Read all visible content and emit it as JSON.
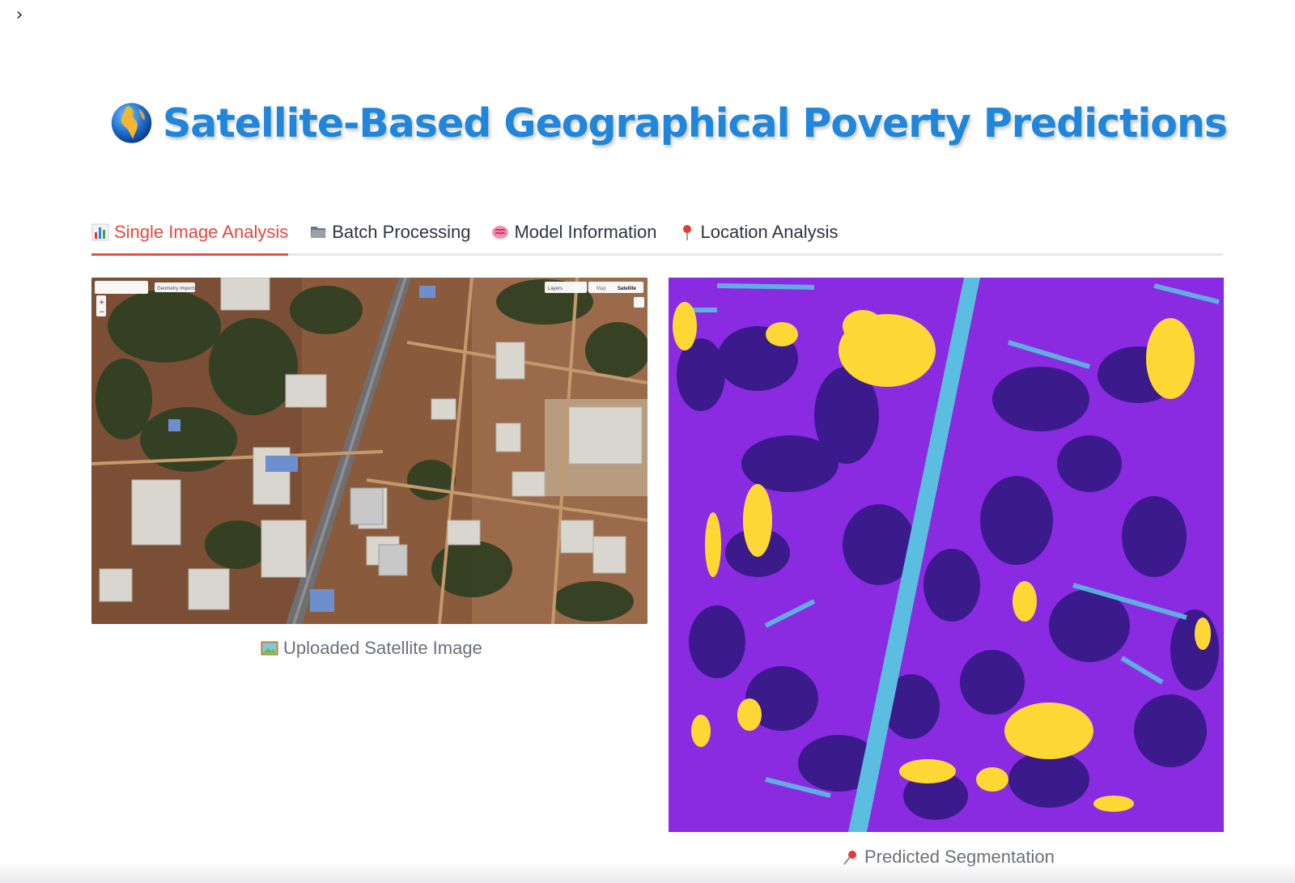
{
  "sidebar": {
    "toggle_glyph": "›"
  },
  "header": {
    "icon": "globe-icon",
    "title": "Satellite-Based Geographical Poverty Predictions"
  },
  "tabs": [
    {
      "label": "Single Image Analysis",
      "icon": "bar-chart-icon",
      "active": true
    },
    {
      "label": "Batch Processing",
      "icon": "folder-icon",
      "active": false
    },
    {
      "label": "Model Information",
      "icon": "brain-icon",
      "active": false
    },
    {
      "label": "Location Analysis",
      "icon": "pin-icon",
      "active": false
    }
  ],
  "uploaded_image": {
    "caption": "Uploaded Satellite Image",
    "caption_icon": "picture-icon",
    "map_controls": {
      "import_label": "Geometry Imports",
      "layers_label": "Layers",
      "map_label": "Map",
      "satellite_label": "Satellite"
    }
  },
  "segmentation": {
    "caption": "Predicted Segmentation",
    "caption_icon": "pushpin-icon",
    "colors": {
      "background": "#8a2be2",
      "dark": "#3b1a8c",
      "light": "#5bbde0",
      "highlight": "#fdd835"
    }
  },
  "colors": {
    "title": "#1f86dc",
    "active_tab": "#e8463e",
    "tab_underline": "#ef4b45"
  }
}
